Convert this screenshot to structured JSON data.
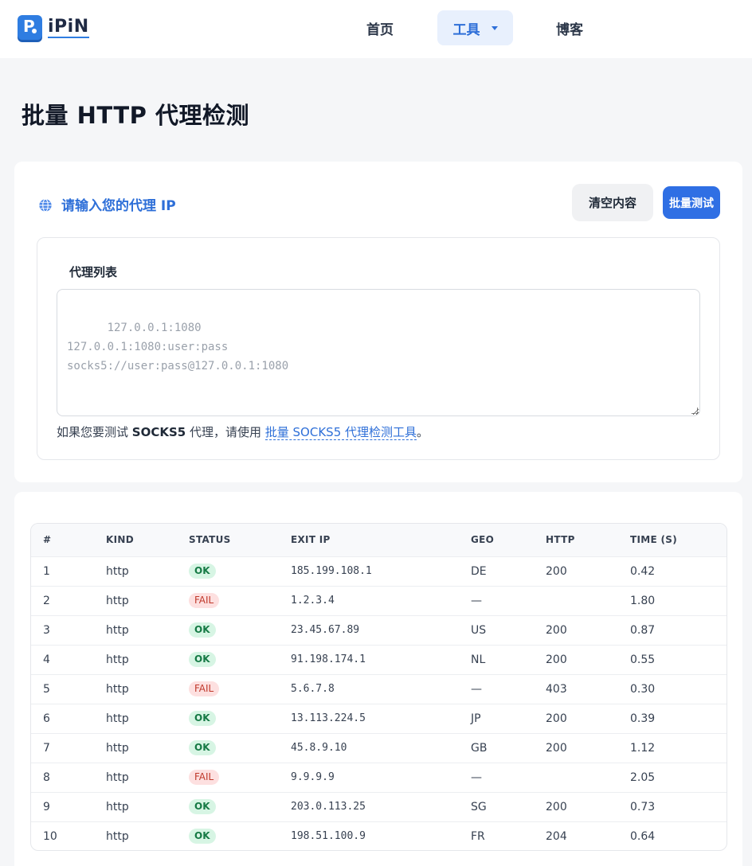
{
  "header": {
    "logo_text": "iPiN",
    "logo_mark": "P",
    "nav": {
      "home": "首页",
      "tools": "工具",
      "blog": "博客"
    }
  },
  "page": {
    "title": "批量 HTTP 代理检测"
  },
  "input_card": {
    "icon": "globe-icon",
    "title": "请输入您的代理 IP",
    "clear_button": "清空内容",
    "test_button": "批量测试",
    "list_label": "代理列表",
    "placeholder": "127.0.0.1:1080\n127.0.0.1:1080:user:pass\nsocks5://user:pass@127.0.0.1:1080",
    "hint_prefix": "如果您要测试 ",
    "hint_bold": "SOCKS5",
    "hint_middle": " 代理，请使用 ",
    "hint_link": "批量 SOCKS5 代理检测工具",
    "hint_suffix": "。"
  },
  "results": {
    "columns": [
      "#",
      "KIND",
      "STATUS",
      "EXIT IP",
      "GEO",
      "HTTP",
      "TIME (S)"
    ],
    "rows": [
      {
        "n": "1",
        "kind": "http",
        "status": "OK",
        "ip": "185.199.108.1",
        "geo": "DE",
        "http": "200",
        "time": "0.42"
      },
      {
        "n": "2",
        "kind": "http",
        "status": "FAIL",
        "ip": "1.2.3.4",
        "geo": "—",
        "http": "",
        "time": "1.80"
      },
      {
        "n": "3",
        "kind": "http",
        "status": "OK",
        "ip": "23.45.67.89",
        "geo": "US",
        "http": "200",
        "time": "0.87"
      },
      {
        "n": "4",
        "kind": "http",
        "status": "OK",
        "ip": "91.198.174.1",
        "geo": "NL",
        "http": "200",
        "time": "0.55"
      },
      {
        "n": "5",
        "kind": "http",
        "status": "FAIL",
        "ip": "5.6.7.8",
        "geo": "—",
        "http": "403",
        "time": "0.30"
      },
      {
        "n": "6",
        "kind": "http",
        "status": "OK",
        "ip": "13.113.224.5",
        "geo": "JP",
        "http": "200",
        "time": "0.39"
      },
      {
        "n": "7",
        "kind": "http",
        "status": "OK",
        "ip": "45.8.9.10",
        "geo": "GB",
        "http": "200",
        "time": "1.12"
      },
      {
        "n": "8",
        "kind": "http",
        "status": "FAIL",
        "ip": "9.9.9.9",
        "geo": "—",
        "http": "",
        "time": "2.05"
      },
      {
        "n": "9",
        "kind": "http",
        "status": "OK",
        "ip": "203.0.113.25",
        "geo": "SG",
        "http": "200",
        "time": "0.73"
      },
      {
        "n": "10",
        "kind": "http",
        "status": "OK",
        "ip": "198.51.100.9",
        "geo": "FR",
        "http": "204",
        "time": "0.64"
      }
    ]
  },
  "colors": {
    "accent": "#2e6fd8",
    "ok_bg": "#d7f5e4",
    "fail_bg": "#fde0e0"
  }
}
